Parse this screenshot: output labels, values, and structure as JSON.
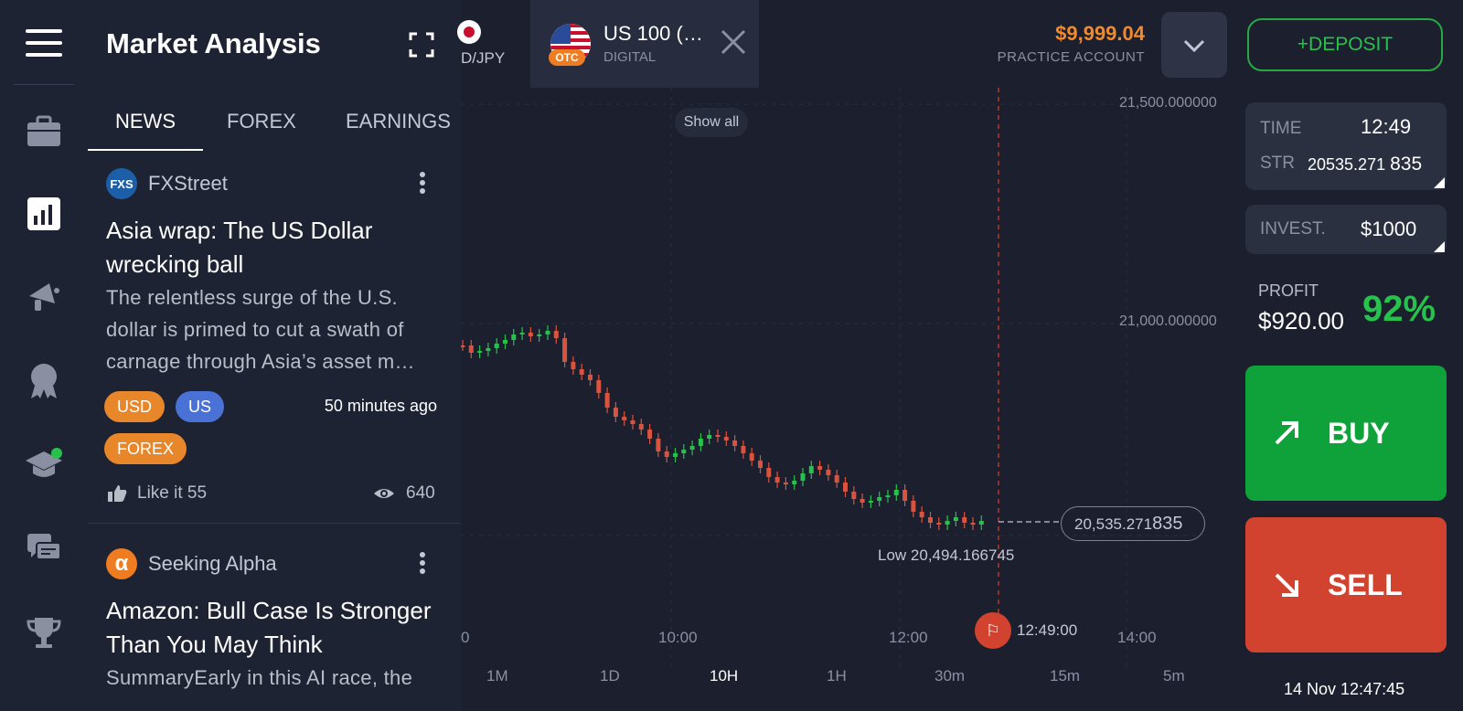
{
  "app": {
    "panel_title": "Market Analysis"
  },
  "news": {
    "tabs": [
      {
        "label": "NEWS",
        "active": true
      },
      {
        "label": "FOREX",
        "active": false
      },
      {
        "label": "EARNINGS",
        "active": false
      }
    ],
    "articles": [
      {
        "source": "FXStreet",
        "source_logo_text": "FXS",
        "headline": "Asia wrap: The US Dollar wrecking ball",
        "summary": "The relentless surge of the U.S. dollar is primed to cut a swath of carnage through Asia’s asset m…",
        "tags": [
          "USD",
          "US",
          "FOREX"
        ],
        "time_ago": "50 minutes ago",
        "like_label": "Like it 55",
        "views": "640"
      },
      {
        "source": "Seeking Alpha",
        "source_logo_text": "α",
        "headline": "Amazon: Bull Case Is Stronger Than You May Think",
        "summary": "SummaryEarly in this AI race, the"
      }
    ]
  },
  "asset_tabs": {
    "first_partial_label": "D/JPY",
    "active": {
      "name": "US 100 (…",
      "type": "DIGITAL",
      "badge": "OTC"
    }
  },
  "account": {
    "balance": "$9,999.04",
    "label": "PRACTICE ACCOUNT",
    "deposit_label": "+DEPOSIT"
  },
  "chart": {
    "show_all_label": "Show all",
    "y_labels": [
      "21,500.000000",
      "21,000.000000"
    ],
    "x_labels": [
      "0",
      "10:00",
      "12:00",
      "14:00"
    ],
    "current_price_main": "20,535.271",
    "current_price_tail": "835",
    "low_label": "Low 20,494.166745",
    "expiry_time": "12:49:00",
    "timeframes": [
      {
        "label": "1M",
        "active": false
      },
      {
        "label": "1D",
        "active": false
      },
      {
        "label": "10H",
        "active": true
      },
      {
        "label": "1H",
        "active": false
      },
      {
        "label": "30m",
        "active": false
      },
      {
        "label": "15m",
        "active": false
      },
      {
        "label": "5m",
        "active": false
      }
    ]
  },
  "trade": {
    "time_label": "TIME",
    "time_value": "12:49",
    "strike_label": "STR",
    "strike_main": "20535.271",
    "strike_tail": "835",
    "invest_label": "INVEST.",
    "invest_value": "$1000",
    "profit_label": "PROFIT",
    "profit_value": "$920.00",
    "profit_pct": "92%",
    "buy_label": "BUY",
    "sell_label": "SELL",
    "datetime": "14 Nov 12:47:45"
  },
  "colors": {
    "buy": "#10a23a",
    "sell": "#d2432f",
    "up_candle": "#27c24c",
    "down_candle": "#d9543f",
    "balance": "#f08a2c"
  }
}
